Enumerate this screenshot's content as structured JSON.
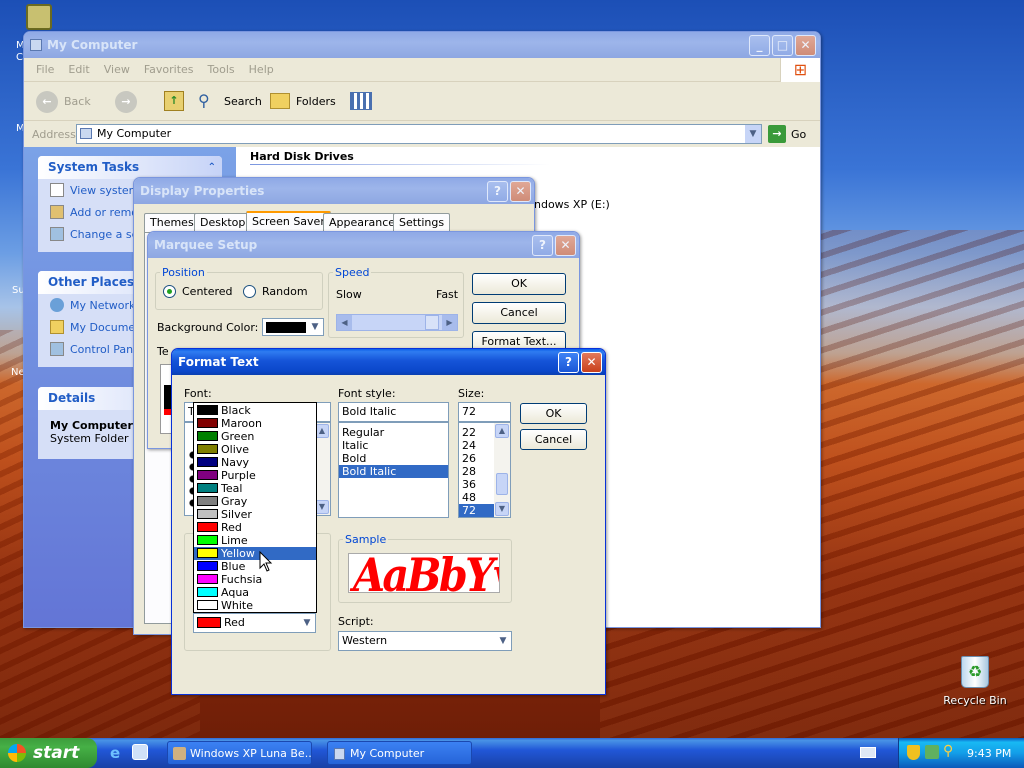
{
  "desktop": {
    "recycle_bin_label": "Recycle Bin",
    "edge_labels": [
      "M",
      "C",
      "M",
      "Su",
      "Ne"
    ]
  },
  "explorer": {
    "title": "My Computer",
    "menu": [
      "File",
      "Edit",
      "View",
      "Favorites",
      "Tools",
      "Help"
    ],
    "toolbar": {
      "back": "Back",
      "search": "Search",
      "folders": "Folders"
    },
    "address_label": "Address",
    "address_value": "My Computer",
    "go_label": "Go",
    "system_tasks": {
      "title": "System Tasks",
      "items": [
        "View system",
        "Add or remo",
        "Change a se"
      ]
    },
    "other_places": {
      "title": "Other Places",
      "items": [
        "My Network",
        "My Documen",
        "Control Pane"
      ]
    },
    "details": {
      "title": "Details",
      "name": "My Computer",
      "type": "System Folder"
    },
    "content_heading": "Hard Disk Drives",
    "drive_fragment": "ndows XP (E:)"
  },
  "display_props": {
    "title": "Display Properties",
    "tabs": [
      "Themes",
      "Desktop",
      "Screen Saver",
      "Appearance",
      "Settings"
    ],
    "active_tab": "Screen Saver"
  },
  "marquee": {
    "title": "Marquee Setup",
    "position_legend": "Position",
    "centered": "Centered",
    "random": "Random",
    "speed_legend": "Speed",
    "slow": "Slow",
    "fast": "Fast",
    "bg_color_label": "Background Color:",
    "bg_color_value": "#000000",
    "ok": "OK",
    "cancel": "Cancel",
    "format_text": "Format Text...",
    "text_label_fragment": "Te"
  },
  "format_text": {
    "title": "Format Text",
    "font_label": "Font:",
    "font_value_fragment": "T",
    "style_label": "Font style:",
    "style_value": "Bold Italic",
    "styles": [
      "Regular",
      "Italic",
      "Bold",
      "Bold Italic"
    ],
    "selected_style": "Bold Italic",
    "size_label": "Size:",
    "size_value": "72",
    "sizes": [
      "22",
      "24",
      "26",
      "28",
      "36",
      "48",
      "72"
    ],
    "selected_size": "72",
    "ok": "OK",
    "cancel": "Cancel",
    "sample_legend": "Sample",
    "sample_text": "AaBbYyZz",
    "sample_color": "#ff0000",
    "script_label": "Script:",
    "script_value": "Western",
    "color_value": "Red",
    "color_value_hex": "#ff0000",
    "color_options": [
      {
        "name": "Black",
        "hex": "#000000"
      },
      {
        "name": "Maroon",
        "hex": "#800000"
      },
      {
        "name": "Green",
        "hex": "#008000"
      },
      {
        "name": "Olive",
        "hex": "#808000"
      },
      {
        "name": "Navy",
        "hex": "#000080"
      },
      {
        "name": "Purple",
        "hex": "#800080"
      },
      {
        "name": "Teal",
        "hex": "#008080"
      },
      {
        "name": "Gray",
        "hex": "#808080"
      },
      {
        "name": "Silver",
        "hex": "#c0c0c0"
      },
      {
        "name": "Red",
        "hex": "#ff0000"
      },
      {
        "name": "Lime",
        "hex": "#00ff00"
      },
      {
        "name": "Yellow",
        "hex": "#ffff00"
      },
      {
        "name": "Blue",
        "hex": "#0000ff"
      },
      {
        "name": "Fuchsia",
        "hex": "#ff00ff"
      },
      {
        "name": "Aqua",
        "hex": "#00ffff"
      },
      {
        "name": "White",
        "hex": "#ffffff"
      }
    ],
    "highlighted_color": "Yellow"
  },
  "taskbar": {
    "start": "start",
    "tasks": [
      "Windows XP Luna Be...",
      "My Computer"
    ],
    "clock": "9:43 PM"
  }
}
